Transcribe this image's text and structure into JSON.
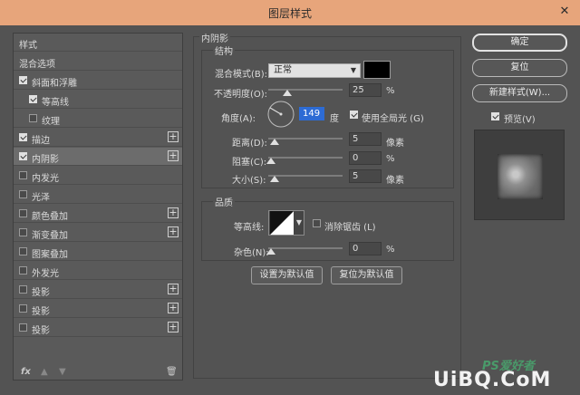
{
  "window": {
    "title": "图层样式",
    "close_glyph": "✕"
  },
  "styles": {
    "items": [
      {
        "label": "样式",
        "checkbox": false,
        "plus": false,
        "indent": 0,
        "selected": false
      },
      {
        "label": "混合选项",
        "checkbox": false,
        "plus": false,
        "indent": 0,
        "selected": false
      },
      {
        "label": "斜面和浮雕",
        "checkbox": true,
        "checked": true,
        "plus": false,
        "indent": 0,
        "selected": false
      },
      {
        "label": "等高线",
        "checkbox": true,
        "checked": true,
        "plus": false,
        "indent": 1,
        "selected": false
      },
      {
        "label": "纹理",
        "checkbox": true,
        "checked": false,
        "plus": false,
        "indent": 1,
        "selected": false
      },
      {
        "label": "描边",
        "checkbox": true,
        "checked": true,
        "plus": true,
        "indent": 0,
        "selected": false
      },
      {
        "label": "内阴影",
        "checkbox": true,
        "checked": true,
        "plus": true,
        "indent": 0,
        "selected": true
      },
      {
        "label": "内发光",
        "checkbox": true,
        "checked": false,
        "plus": false,
        "indent": 0,
        "selected": false
      },
      {
        "label": "光泽",
        "checkbox": true,
        "checked": false,
        "plus": false,
        "indent": 0,
        "selected": false
      },
      {
        "label": "颜色叠加",
        "checkbox": true,
        "checked": false,
        "plus": true,
        "indent": 0,
        "selected": false
      },
      {
        "label": "渐变叠加",
        "checkbox": true,
        "checked": false,
        "plus": true,
        "indent": 0,
        "selected": false
      },
      {
        "label": "图案叠加",
        "checkbox": true,
        "checked": false,
        "plus": false,
        "indent": 0,
        "selected": false
      },
      {
        "label": "外发光",
        "checkbox": true,
        "checked": false,
        "plus": false,
        "indent": 0,
        "selected": false
      },
      {
        "label": "投影",
        "checkbox": true,
        "checked": false,
        "plus": true,
        "indent": 0,
        "selected": false
      },
      {
        "label": "投影",
        "checkbox": true,
        "checked": false,
        "plus": true,
        "indent": 0,
        "selected": false
      },
      {
        "label": "投影",
        "checkbox": true,
        "checked": false,
        "plus": true,
        "indent": 0,
        "selected": false
      }
    ],
    "footer_icons": {
      "fx": "fx",
      "up": "▲",
      "down": "▼",
      "trash": "🗑"
    }
  },
  "inner_shadow": {
    "section_title": "内阴影",
    "structure": {
      "title": "结构",
      "blend_mode_label": "混合模式(B):",
      "blend_mode_value": "正常",
      "shadow_color": "#000000",
      "opacity_label": "不透明度(O):",
      "opacity_value": "25",
      "opacity_fraction": 0.25,
      "opacity_unit": "%",
      "angle_label": "角度(A):",
      "angle_value": "149",
      "angle_unit": "度",
      "global_light_label": "使用全局光 (G)",
      "global_light_checked": true,
      "distance_label": "距离(D):",
      "distance_value": "5",
      "distance_unit": "像素",
      "choke_label": "阻塞(C):",
      "choke_value": "0",
      "choke_unit": "%",
      "size_label": "大小(S):",
      "size_value": "5",
      "size_unit": "像素"
    },
    "quality": {
      "title": "品质",
      "contour_label": "等高线:",
      "antialias_label": "消除锯齿 (L)",
      "antialias_checked": false,
      "noise_label": "杂色(N):",
      "noise_value": "0",
      "noise_unit": "%"
    },
    "set_default_label": "设置为默认值",
    "reset_default_label": "复位为默认值"
  },
  "actions": {
    "ok": "确定",
    "reset": "复位",
    "new_style": "新建样式(W)...",
    "preview_label": "预览(V)",
    "preview_checked": true
  },
  "watermark": {
    "brand": "PS爱好者",
    "site": "UiBQ.CoM"
  },
  "colors": {
    "title_bar": "#e7a57b",
    "panel": "#535353",
    "selected_row": "#6c6c6c",
    "angle_highlight": "#2d6bd4"
  }
}
